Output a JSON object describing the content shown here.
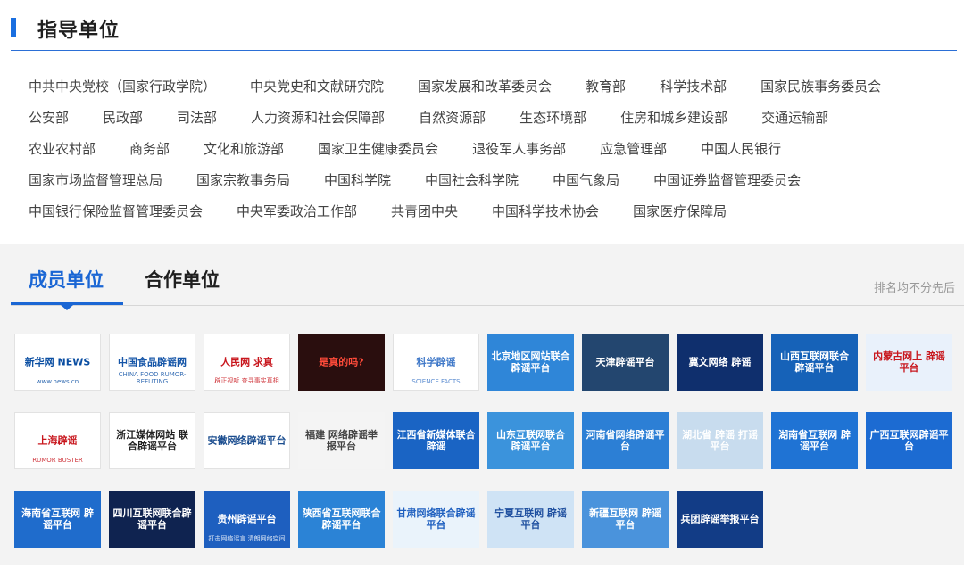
{
  "guide": {
    "title": "指导单位",
    "rows": [
      [
        "中共中央党校（国家行政学院）",
        "中央党史和文献研究院",
        "国家发展和改革委员会",
        "教育部",
        "科学技术部",
        "国家民族事务委员会"
      ],
      [
        "公安部",
        "民政部",
        "司法部",
        "人力资源和社会保障部",
        "自然资源部",
        "生态环境部",
        "住房和城乡建设部",
        "交通运输部"
      ],
      [
        "农业农村部",
        "商务部",
        "文化和旅游部",
        "国家卫生健康委员会",
        "退役军人事务部",
        "应急管理部",
        "中国人民银行"
      ],
      [
        "国家市场监督管理总局",
        "国家宗教事务局",
        "中国科学院",
        "中国社会科学院",
        "中国气象局",
        "中国证券监督管理委员会"
      ],
      [
        "中国银行保险监督管理委员会",
        "中央军委政治工作部",
        "共青团中央",
        "中国科学技术协会",
        "国家医疗保障局"
      ]
    ]
  },
  "members": {
    "tabs": [
      "成员单位",
      "合作单位"
    ],
    "active_tab": 0,
    "rank_note": "排名均不分先后",
    "logo_rows": [
      [
        {
          "name": "xinhua-logo",
          "text": "新华网 NEWS",
          "sub": "www.news.cn",
          "bg": "#ffffff",
          "fg": "#0a4ea2"
        },
        {
          "name": "china-food-rumor-logo",
          "text": "中国食品辟谣网",
          "sub": "CHINA FOOD RUMOR-REFUTING",
          "bg": "#ffffff",
          "fg": "#1656a8"
        },
        {
          "name": "people-qiuzhen-logo",
          "text": "人民网 求真",
          "sub": "辟正视听 查寻事实真相",
          "bg": "#ffffff",
          "fg": "#c8161d"
        },
        {
          "name": "zhenjia-logo",
          "text": "是真的吗?",
          "sub": "",
          "bg": "#2a0e0e",
          "fg": "#ff4b3a"
        },
        {
          "name": "science-rumor-logo",
          "text": "科学辟谣",
          "sub": "SCIENCE FACTS",
          "bg": "#ffffff",
          "fg": "#3f78c8"
        },
        {
          "name": "beijing-rumor-logo",
          "text": "北京地区网站联合 辟谣平台",
          "sub": "",
          "bg": "#2f86d8",
          "fg": "#ffffff"
        },
        {
          "name": "tianjin-rumor-logo",
          "text": "天津辟谣平台",
          "sub": "",
          "bg": "#23466f",
          "fg": "#ffffff"
        },
        {
          "name": "hebei-rumor-logo",
          "text": "冀文网络 辟谣",
          "sub": "",
          "bg": "#0f2f6d",
          "fg": "#ffffff"
        },
        {
          "name": "shanxi-rumor-logo",
          "text": "山西互联网联合 辟谣平台",
          "sub": "",
          "bg": "#1662b8",
          "fg": "#ffffff"
        },
        {
          "name": "neimenggu-rumor-logo",
          "text": "内蒙古网上 辟谣平台",
          "sub": "",
          "bg": "#e9f1fb",
          "fg": "#c8161d"
        }
      ],
      [
        {
          "name": "shanghai-rumor-logo",
          "text": "上海辟谣",
          "sub": "RUMOR BUSTER",
          "bg": "#ffffff",
          "fg": "#c8161d"
        },
        {
          "name": "zhejiang-rumor-logo",
          "text": "浙江媒体网站 联合辟谣平台",
          "sub": "",
          "bg": "#ffffff",
          "fg": "#222222"
        },
        {
          "name": "anhui-rumor-logo",
          "text": "安徽网络辟谣平台",
          "sub": "",
          "bg": "#ffffff",
          "fg": "#1b4d8f"
        },
        {
          "name": "fujian-rumor-logo",
          "text": "福建 网络辟谣举报平台",
          "sub": "",
          "bg": "#f4f4f4",
          "fg": "#444444"
        },
        {
          "name": "jiangxi-rumor-logo",
          "text": "江西省新媒体联合 辟谣",
          "sub": "",
          "bg": "#1a64c4",
          "fg": "#ffffff"
        },
        {
          "name": "shandong-rumor-logo",
          "text": "山东互联网联合 辟谣平台",
          "sub": "",
          "bg": "#3b93dc",
          "fg": "#ffffff"
        },
        {
          "name": "henan-rumor-logo",
          "text": "河南省网络辟谣平台",
          "sub": "",
          "bg": "#2c7fd5",
          "fg": "#ffffff"
        },
        {
          "name": "hubei-rumor-logo",
          "text": "湖北省 辟谣 打谣平台",
          "sub": "",
          "bg": "#c8dcee",
          "fg": "#ffffff"
        },
        {
          "name": "hunan-rumor-logo",
          "text": "湖南省互联网 辟谣平台",
          "sub": "",
          "bg": "#1f73d4",
          "fg": "#ffffff"
        },
        {
          "name": "guangxi-rumor-logo",
          "text": "广西互联网辟谣平台",
          "sub": "",
          "bg": "#1c6bd2",
          "fg": "#ffffff"
        }
      ],
      [
        {
          "name": "hainan-rumor-logo",
          "text": "海南省互联网 辟谣平台",
          "sub": "",
          "bg": "#1f6ccc",
          "fg": "#ffffff"
        },
        {
          "name": "sichuan-rumor-logo",
          "text": "四川互联网联合辟谣平台",
          "sub": "",
          "bg": "#0f2350",
          "fg": "#ffffff"
        },
        {
          "name": "guizhou-rumor-logo",
          "text": "贵州辟谣平台",
          "sub": "打击网络谣言 清朗网络空间",
          "bg": "#1e5fbf",
          "fg": "#ffffff"
        },
        {
          "name": "shaanxi-rumor-logo",
          "text": "陕西省互联网联合 辟谣平台",
          "sub": "",
          "bg": "#2b83d6",
          "fg": "#ffffff"
        },
        {
          "name": "gansu-rumor-logo",
          "text": "甘肃网络联合辟谣平台",
          "sub": "",
          "bg": "#eaf3fb",
          "fg": "#1e5fbf"
        },
        {
          "name": "ningxia-rumor-logo",
          "text": "宁夏互联网 辟谣平台",
          "sub": "",
          "bg": "#cfe3f5",
          "fg": "#1e4f9f"
        },
        {
          "name": "xinjiang-rumor-logo",
          "text": "新疆互联网 辟谣平台",
          "sub": "",
          "bg": "#4a93dc",
          "fg": "#ffffff"
        },
        {
          "name": "bingtuan-rumor-logo",
          "text": "兵团辟谣举报平台",
          "sub": "",
          "bg": "#123c86",
          "fg": "#ffffff"
        }
      ]
    ]
  }
}
